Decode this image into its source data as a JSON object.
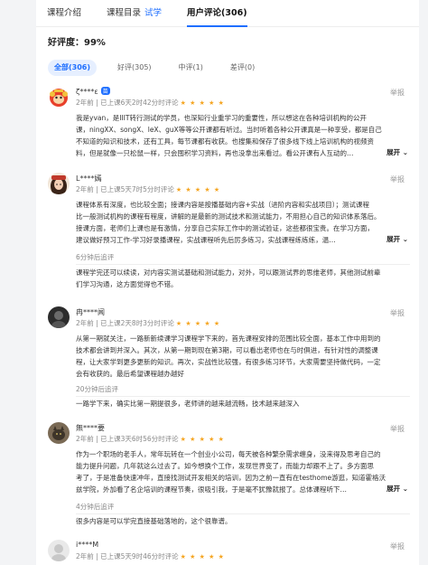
{
  "nav": {
    "intro": "课程介绍",
    "catalog": "课程目录",
    "trial": "试学",
    "reviews": "用户评论(306)"
  },
  "rating": {
    "label": "好评度：",
    "value": "99%"
  },
  "filters": [
    {
      "label": "全部(306)"
    },
    {
      "label": "好评(305)"
    },
    {
      "label": "中评(1)"
    },
    {
      "label": "差评(0)"
    }
  ],
  "colors": {
    "accent": "#1f6fff",
    "star": "#f5a623"
  },
  "report_label": "举报",
  "more_label": "展开",
  "stars": "★ ★ ★ ★ ★",
  "reviews": [
    {
      "name": "ζ****ɛ",
      "badge": "苗",
      "meta": "2年前 | 已上课6天2时42分时评论",
      "avatar": "monkey-avatar",
      "lines": [
        "我是yvan，是IIIT转行测试的学员，也深知行业重学习的重要性，所以想这在各种培训机构的公开",
        "课，ningXX、songX、leX、guX等等公开课都有听过。当时听着各种公开课真是一种享受，都是自己",
        "不知道的知识和技术，还有工具，每节课都有收获。也搜集和保存了很多线下线上培训机构的视频资",
        "料，但是就像一只松鼠一样，只会囤积学习资料，再也没拿出来看过。看公开课有人互动的…"
      ]
    },
    {
      "name": "L****嫣",
      "meta": "2年前 | 已上课5天7时5分时评论",
      "avatar": "girl-avatar",
      "lines": [
        "课程体系有深度，也比较全面；接课内容是按播基础内容+实战（进阶内容和实战项目）；测试课程",
        "比一般测试机构的课程有程度，讲解的是最新的测试技术和测试能力，不用担心自己的知识体系落后。",
        "接课方面，老师们上课也是有激情，分享自己实际工作中的测试验证，这些都很宝贵。在学习方面，",
        "建议做好预习工作-学习好录播课程，实战课程听先后厉多练习，实战课程练练练，温…"
      ],
      "follow_title": "6分钟后追评",
      "follow_lines": [
        "课程学完还可以续读，对内容实测试基础和测试能力，对外，可以跟测试界的思维老师，其他测试前辈",
        "们学习沟通，这方面觉得也不错。"
      ]
    },
    {
      "name": "冉****闻",
      "meta": "2年前 | 已上课2天8时3分时评论",
      "avatar": "dark-avatar",
      "lines": [
        "从第一期就关注，一路新新续课学习课程学下来的，首先课程安排的范围比较全面，基本工作中用到的",
        "技术都会讲到并深入。其次，从第一期到现在第3期，可以看出老师也在与时俱进，有针对性的调整课",
        "程，让大家学到更多更新的知识。再次，实战性比较强，有很多练习环节，大家需要坚持做代码，一定",
        "会有收获的。最后希望课程越办越好"
      ],
      "follow_title": "20分钟后追评",
      "follow_lines": [
        "一路学下来，确实比第一期提很多，老师讲的越来越流畅，技术越来越深入"
      ]
    },
    {
      "name": "無****要",
      "meta": "2年前 | 已上课3天6时56分时评论",
      "avatar": "cat-avatar",
      "lines": [
        "作为一个职场的老手人，常年玩转在一个创业小公司，每天被各种繁杂需求缠身，没来得及思考自己的",
        "能力提升问题，几年就这么过去了。如今想换个工作，发现世界变了，而能力却跟不上了。多方面思",
        "考了，于是准备快速冲年，直接找测试开发相关的培训，因为之前一直有在testhome游逛，知道霍格沃",
        "兹学院，外加看了名企培训的课程节奏，很吸引我，于是毫不犹豫就报了。总体课程听下…"
      ],
      "follow_title": "4分钟后追评",
      "follow_lines": [
        "很多内容是可以学完直接基础落地的，这个很靠谱。"
      ]
    },
    {
      "name": "i****M",
      "meta": "2年前 | 已上课5天9时46分时评论",
      "avatar": "light-avatar"
    }
  ]
}
